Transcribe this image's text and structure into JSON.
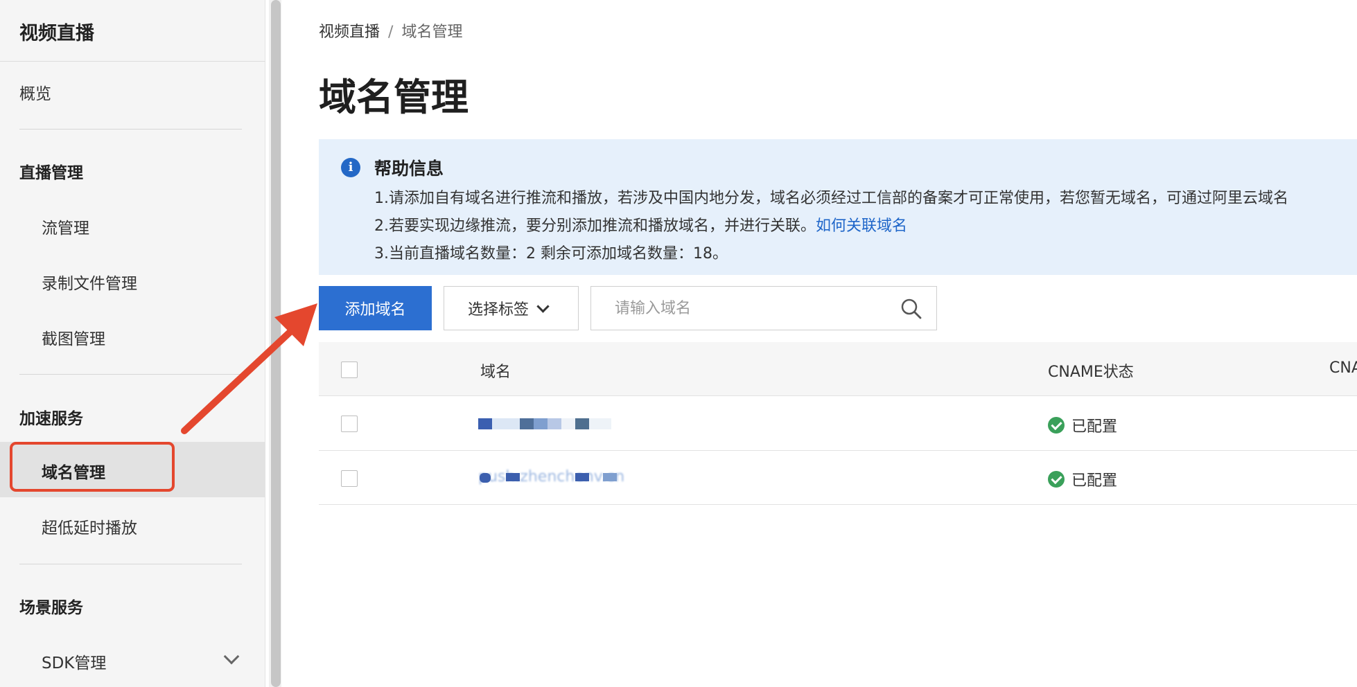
{
  "sidebar": {
    "title": "视频直播",
    "overview": "概览",
    "groups": {
      "live_manage": "直播管理",
      "acceleration": "加速服务",
      "scene": "场景服务"
    },
    "items": {
      "stream_manage": "流管理",
      "record_manage": "录制文件管理",
      "snapshot_manage": "截图管理",
      "domain_manage": "域名管理",
      "low_latency": "超低延时播放",
      "sdk_manage": "SDK管理"
    },
    "active_item": "域名管理"
  },
  "breadcrumb": {
    "root": "视频直播",
    "separator": "/",
    "current": "域名管理"
  },
  "page_title": "域名管理",
  "help": {
    "title": "帮助信息",
    "line1": "1.请添加自有域名进行推流和播放，若涉及中国内地分发，域名必须经过工信部的备案才可正常使用，若您暂无域名，可通过阿里云域名",
    "line2_prefix": "2.若要实现边缘推流，要分别添加推流和播放域名，并进行关联。",
    "line2_link": "如何关联域名",
    "line3": "3.当前直播域名数量：2 剩余可添加域名数量：18。"
  },
  "toolbar": {
    "add_domain": "添加域名",
    "select_tag": "选择标签",
    "search_placeholder": "请输入域名"
  },
  "table": {
    "columns": [
      "域名",
      "CNAME状态",
      "CNA"
    ],
    "rows": [
      {
        "domain": "",
        "status": "已配置"
      },
      {
        "domain": "push.zhenchenv.cn",
        "status": "已配置"
      }
    ]
  },
  "colors": {
    "primary": "#2c6fd1",
    "highlight": "#e4472e",
    "help_bg": "#e6f0fb",
    "success": "#3aa05a",
    "link": "#1f66c9"
  }
}
